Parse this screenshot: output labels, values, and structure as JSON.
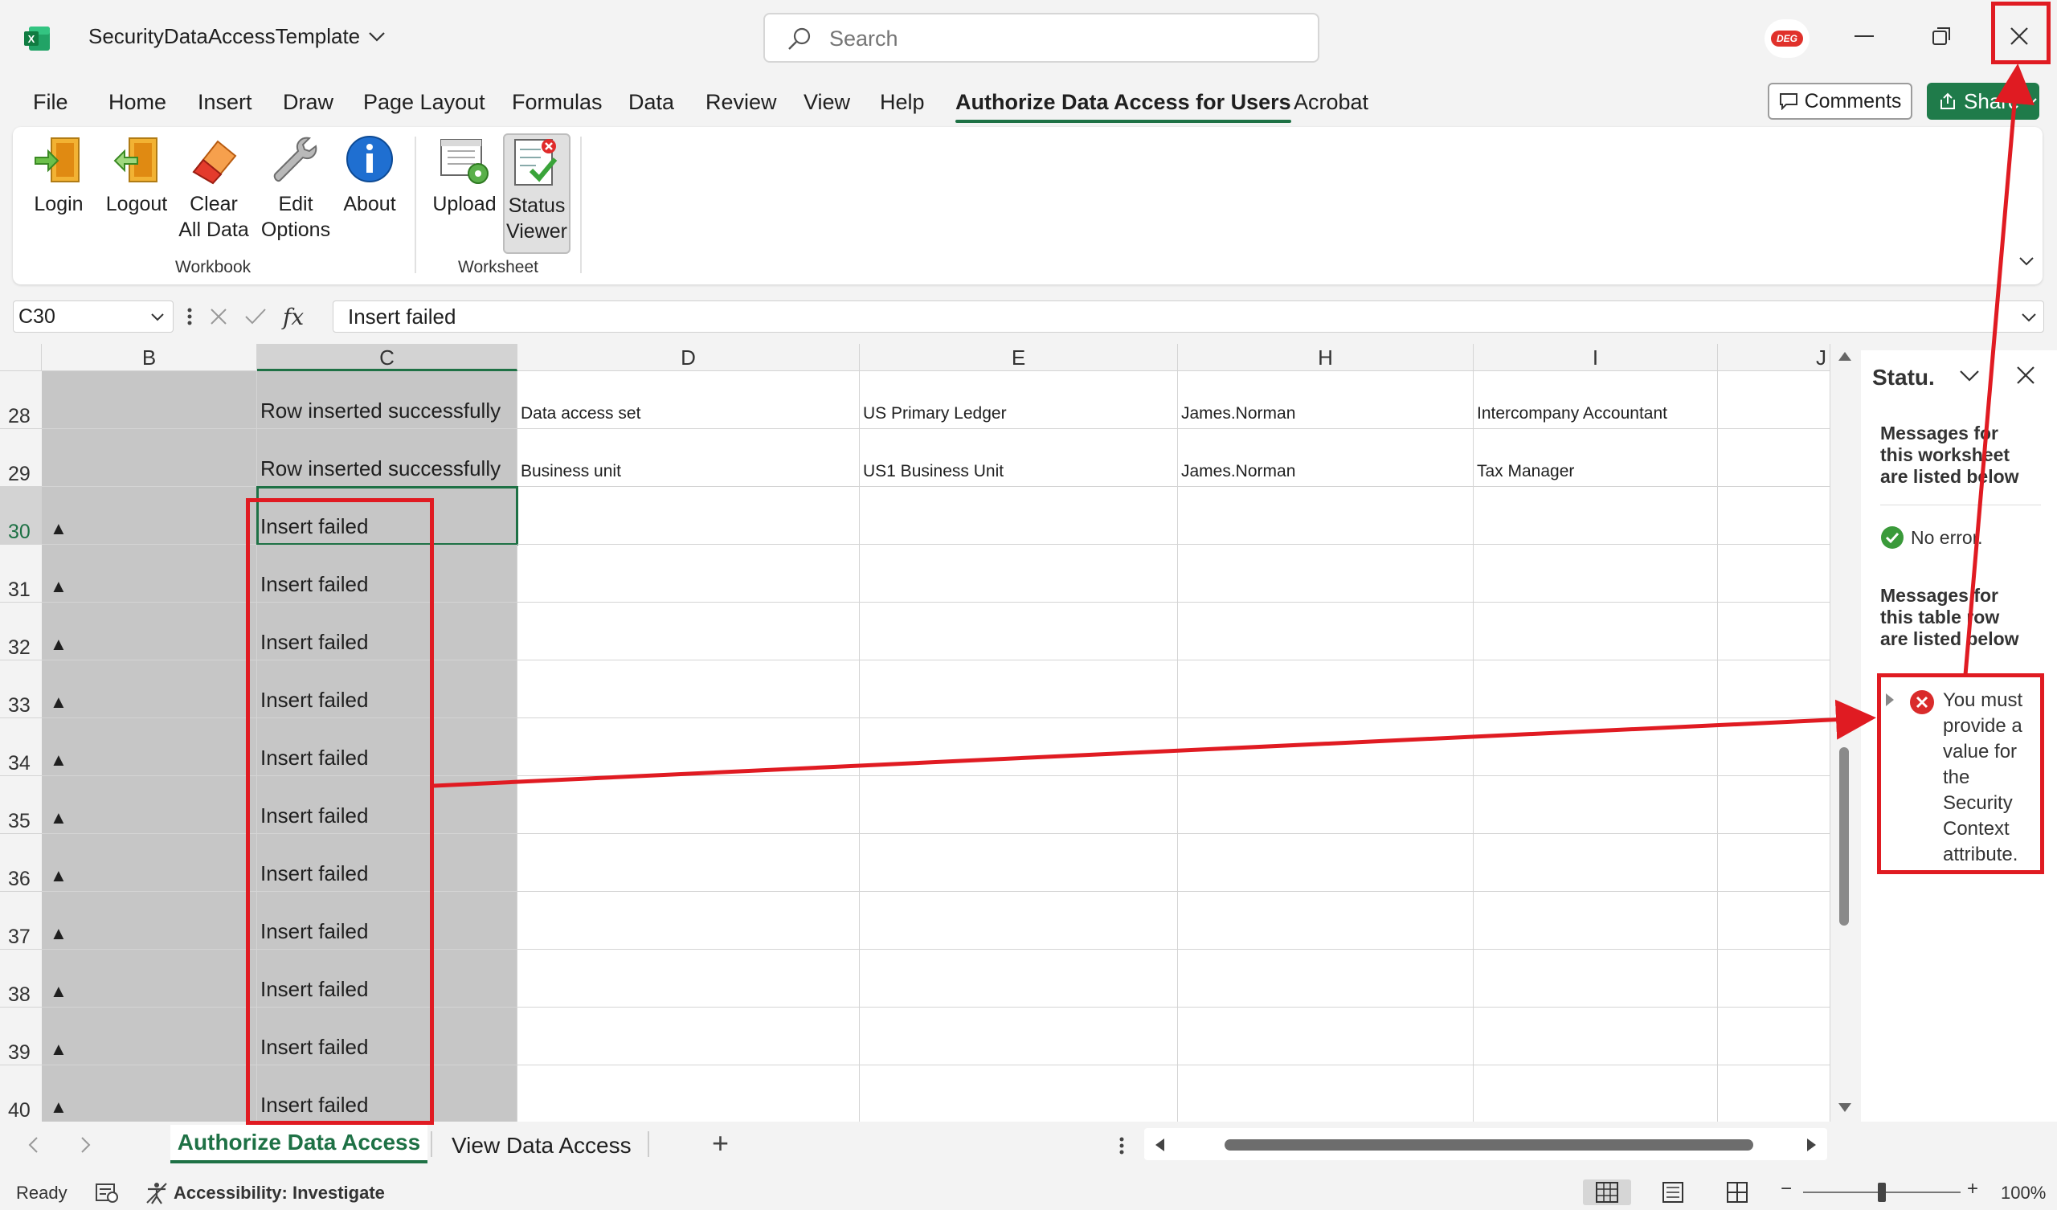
{
  "app": {
    "doc_title": "SecurityDataAccessTemplate",
    "search_placeholder": "Search"
  },
  "menu": [
    "File",
    "Home",
    "Insert",
    "Draw",
    "Page Layout",
    "Formulas",
    "Data",
    "Review",
    "View",
    "Help",
    "Authorize Data Access for Users",
    "Acrobat"
  ],
  "menu_active": "Authorize Data Access for Users",
  "header_buttons": {
    "comments": "Comments",
    "share": "Share"
  },
  "ribbon": {
    "login": "Login",
    "logout": "Logout",
    "clear_1": "Clear",
    "clear_2": "All Data",
    "edit_1": "Edit",
    "edit_2": "Options",
    "about": "About",
    "upload": "Upload",
    "status_1": "Status",
    "status_2": "Viewer",
    "group_workbook": "Workbook",
    "group_worksheet": "Worksheet"
  },
  "formula_bar": {
    "name_box": "C30",
    "fx": "fx",
    "value": "Insert failed"
  },
  "columns": [
    "B",
    "C",
    "D",
    "E",
    "H",
    "I",
    "J"
  ],
  "rows": [
    {
      "num": "28",
      "b": "",
      "c": "Row inserted successfully",
      "d": "Data access set",
      "e": "US Primary Ledger",
      "h": "James.Norman",
      "i": "Intercompany Accountant"
    },
    {
      "num": "29",
      "b": "",
      "c": "Row inserted successfully",
      "d": "Business unit",
      "e": "US1 Business Unit",
      "h": "James.Norman",
      "i": "Tax Manager"
    },
    {
      "num": "30",
      "b": "▲",
      "c": "Insert failed",
      "d": "",
      "e": "",
      "h": "",
      "i": ""
    },
    {
      "num": "31",
      "b": "▲",
      "c": "Insert failed",
      "d": "",
      "e": "",
      "h": "",
      "i": ""
    },
    {
      "num": "32",
      "b": "▲",
      "c": "Insert failed",
      "d": "",
      "e": "",
      "h": "",
      "i": ""
    },
    {
      "num": "33",
      "b": "▲",
      "c": "Insert failed",
      "d": "",
      "e": "",
      "h": "",
      "i": ""
    },
    {
      "num": "34",
      "b": "▲",
      "c": "Insert failed",
      "d": "",
      "e": "",
      "h": "",
      "i": ""
    },
    {
      "num": "35",
      "b": "▲",
      "c": "Insert failed",
      "d": "",
      "e": "",
      "h": "",
      "i": ""
    },
    {
      "num": "36",
      "b": "▲",
      "c": "Insert failed",
      "d": "",
      "e": "",
      "h": "",
      "i": ""
    },
    {
      "num": "37",
      "b": "▲",
      "c": "Insert failed",
      "d": "",
      "e": "",
      "h": "",
      "i": ""
    },
    {
      "num": "38",
      "b": "▲",
      "c": "Insert failed",
      "d": "",
      "e": "",
      "h": "",
      "i": ""
    },
    {
      "num": "39",
      "b": "▲",
      "c": "Insert failed",
      "d": "",
      "e": "",
      "h": "",
      "i": ""
    },
    {
      "num": "40",
      "b": "▲",
      "c": "Insert failed",
      "d": "",
      "e": "",
      "h": "",
      "i": ""
    }
  ],
  "selected_row": "30",
  "side_pane": {
    "title": "Statu.",
    "ws_heading_1": "Messages for",
    "ws_heading_2": "this worksheet",
    "ws_heading_3": "are listed below",
    "no_error": "No error.",
    "row_heading_1": "Messages for",
    "row_heading_2": "this table row",
    "row_heading_3": "are listed below",
    "message": "You must provide a value for the Security Context attribute."
  },
  "sheet_tabs": {
    "active": "Authorize Data Access",
    "other": "View Data Access",
    "add": "+"
  },
  "status_bar": {
    "ready": "Ready",
    "accessibility": "Accessibility: Investigate",
    "zoom": "100%"
  },
  "colors": {
    "excel_green": "#1e7145",
    "annotation_red": "#e01b22",
    "error_red": "#d92b2b",
    "ok_green": "#3a9a3a"
  }
}
